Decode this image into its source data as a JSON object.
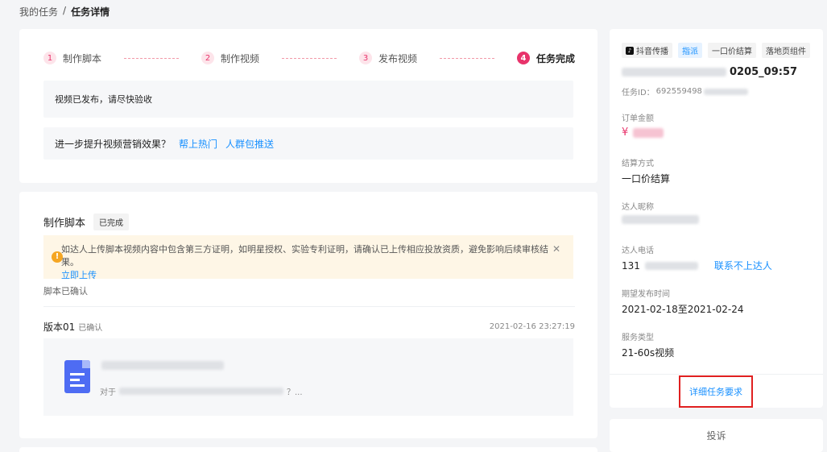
{
  "breadcrumb": {
    "parent": "我的任务",
    "separator": "/",
    "current": "任务详情"
  },
  "steps": [
    {
      "num": "1",
      "label": "制作脚本"
    },
    {
      "num": "2",
      "label": "制作视频"
    },
    {
      "num": "3",
      "label": "发布视频"
    },
    {
      "num": "4",
      "label": "任务完成"
    }
  ],
  "notice": {
    "published": "视频已发布，请尽快验收",
    "promote_text": "进一步提升视频营销效果？",
    "promote_link1": "帮上热门",
    "promote_link2": "人群包推送"
  },
  "script_section": {
    "title": "制作脚本",
    "status_tag": "已完成",
    "warning": "如达人上传脚本视频内容中包含第三方证明，如明星授权、实验专利证明，请确认已上传相应投放资质，避免影响后续审核结果。",
    "warning_close": "✕",
    "upload_link": "立即上传",
    "confirmed_text": "脚本已确认",
    "version_title": "版本01",
    "version_status": "已确认",
    "version_date": "2021-02-16 23:27:19",
    "doc_snippet_prefix": "对于",
    "doc_snippet_suffix": "？..."
  },
  "side": {
    "platform_tag": "抖音传播",
    "tag_assign": "指派",
    "tag_price": "一口价结算",
    "tag_landing": "落地页组件",
    "task_title_suffix": "0205_09:57",
    "task_id_label": "任务ID：",
    "task_id_visible": "692559498",
    "order_amount_label": "订单金额",
    "currency": "¥",
    "settle_label": "结算方式",
    "settle_value": "一口价结算",
    "nickname_label": "达人昵称",
    "phone_label": "达人电话",
    "phone_prefix": "131",
    "contact_link": "联系不上达人",
    "period_label": "期望发布时间",
    "period_value": "2021-02-18至2021-02-24",
    "service_label": "服务类型",
    "service_value": "21-60s视频",
    "detail_button": "详细任务要求",
    "complaint_button": "投诉"
  }
}
